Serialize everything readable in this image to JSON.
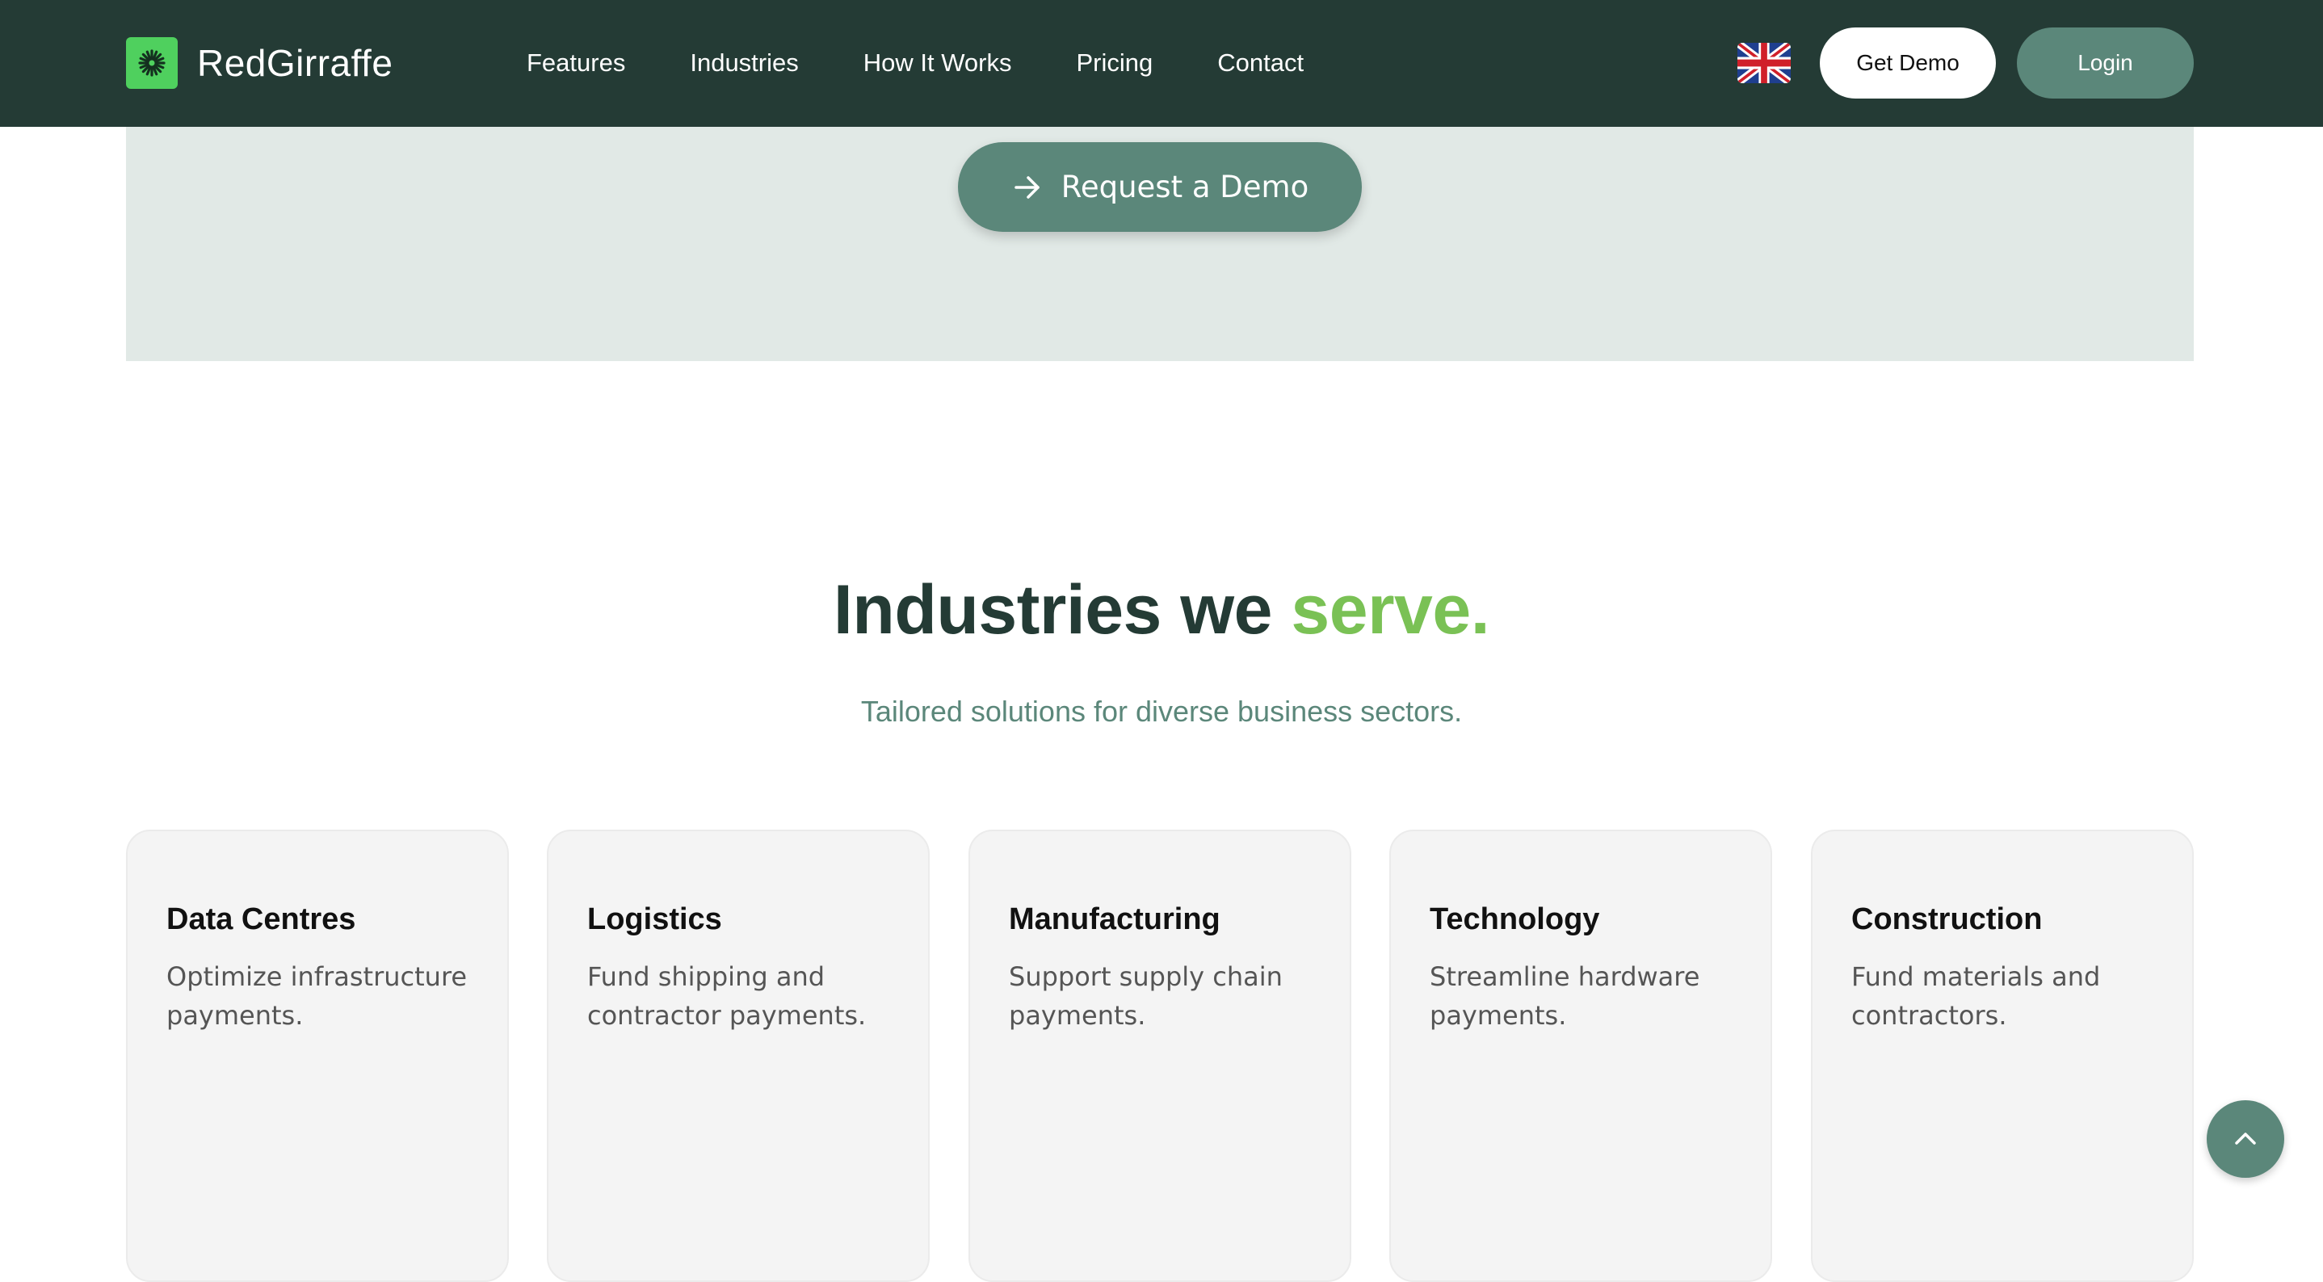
{
  "header": {
    "brand": "RedGirraffe",
    "nav": [
      "Features",
      "Industries",
      "How It Works",
      "Pricing",
      "Contact"
    ],
    "language_icon": "uk-flag-icon",
    "get_demo_label": "Get Demo",
    "login_label": "Login"
  },
  "cta": {
    "request_demo_label": "Request a Demo"
  },
  "industries": {
    "title_main": "Industries we ",
    "title_accent": "serve.",
    "subtitle": "Tailored solutions for diverse business sectors.",
    "cards": [
      {
        "title": "Data Centres",
        "description": "Optimize infrastructure payments."
      },
      {
        "title": "Logistics",
        "description": "Fund shipping and contractor payments."
      },
      {
        "title": "Manufacturing",
        "description": "Support supply chain payments."
      },
      {
        "title": "Technology",
        "description": "Streamline hardware payments."
      },
      {
        "title": "Construction",
        "description": "Fund materials and contractors."
      }
    ]
  },
  "colors": {
    "header_bg": "#243b35",
    "brand_green": "#4fd05e",
    "accent_green": "#7ac155",
    "primary_button": "#5b877a",
    "cta_band": "#e1e9e6",
    "card_bg": "#f4f4f4"
  }
}
